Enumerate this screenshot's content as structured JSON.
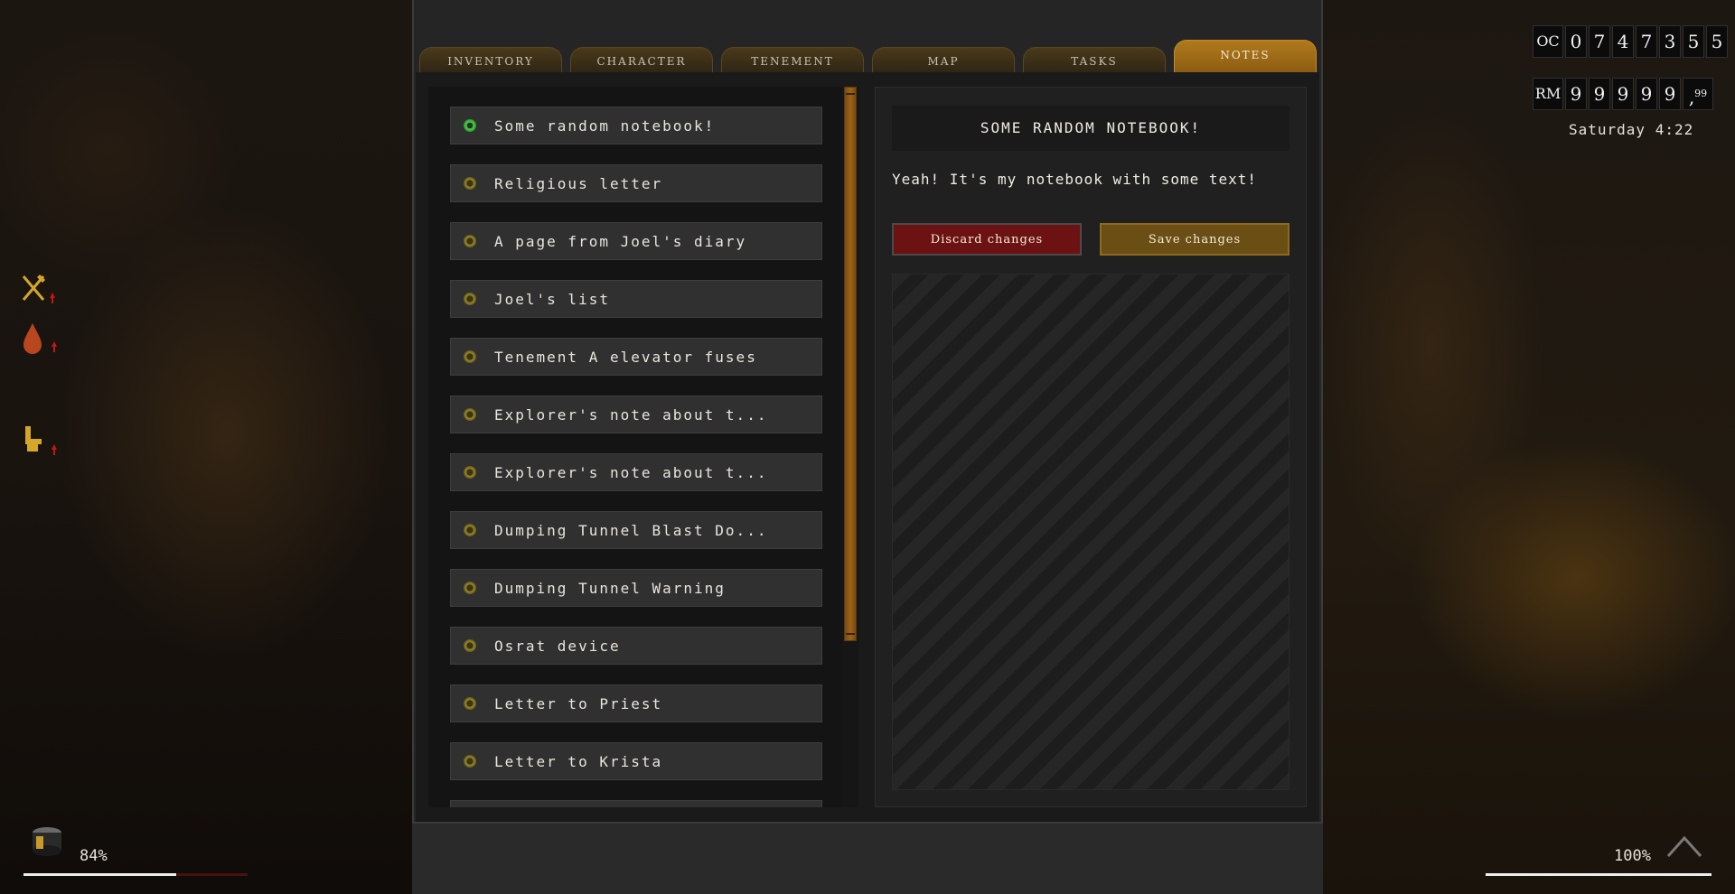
{
  "tabs": [
    {
      "label": "INVENTORY",
      "active": false
    },
    {
      "label": "CHARACTER",
      "active": false
    },
    {
      "label": "TENEMENT",
      "active": false
    },
    {
      "label": "MAP",
      "active": false
    },
    {
      "label": "TASKS",
      "active": false
    },
    {
      "label": "NOTES",
      "active": true
    }
  ],
  "notes": [
    {
      "title": "Some random notebook!",
      "selected": true
    },
    {
      "title": "Religious letter",
      "selected": false
    },
    {
      "title": "A page from Joel's diary",
      "selected": false
    },
    {
      "title": "Joel's list",
      "selected": false
    },
    {
      "title": "Tenement A elevator fuses",
      "selected": false
    },
    {
      "title": "Explorer's note about t...",
      "selected": false
    },
    {
      "title": "Explorer's note about t...",
      "selected": false
    },
    {
      "title": "Dumping Tunnel Blast Do...",
      "selected": false
    },
    {
      "title": "Dumping Tunnel Warning",
      "selected": false
    },
    {
      "title": "Osrat device",
      "selected": false
    },
    {
      "title": "Letter to Priest",
      "selected": false
    },
    {
      "title": "Letter to Krista",
      "selected": false
    }
  ],
  "detail": {
    "title": "SOME RANDOM NOTEBOOK!",
    "text": "Yeah! It's my notebook with some text!",
    "discard_label": "Discard changes",
    "save_label": "Save changes"
  },
  "hud": {
    "battery_percent": "84%",
    "battery_level": 0.68,
    "zoom_percent": "100%",
    "counter_prefix": "OC",
    "counter_digits": [
      "0",
      "7",
      "4",
      "7",
      "3",
      "5",
      "5"
    ],
    "money_prefix": "RM",
    "money_digits": [
      "9",
      "9",
      "9",
      "9",
      "9"
    ],
    "money_cents": "99",
    "day_time": "Saturday 4:22"
  },
  "colors": {
    "accent": "#b07a1c",
    "discard": "#6d1212",
    "selected_dot": "#4fd04f"
  }
}
